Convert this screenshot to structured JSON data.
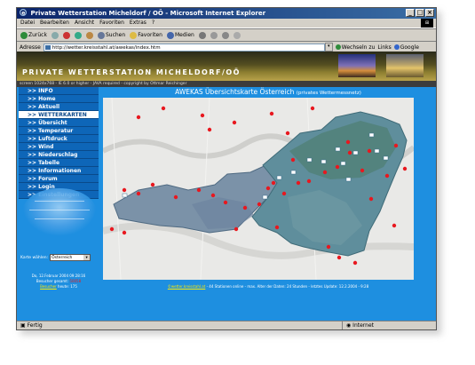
{
  "browser": {
    "window_title": "Private Wetterstation Micheldorf / OÖ - Microsoft Internet Explorer",
    "menu": [
      "Datei",
      "Bearbeiten",
      "Ansicht",
      "Favoriten",
      "Extras",
      "?"
    ],
    "toolbar": {
      "back": "Zurück",
      "search": "Suchen",
      "favorites": "Favoriten",
      "media": "Medien"
    },
    "address_label": "Adresse",
    "address_value": "http://wetter.kreisstahl.at/awekas/index.htm",
    "go_label": "Wechseln zu",
    "links_label": "Links",
    "google_label": "Google"
  },
  "page": {
    "banner_title": "PRIVATE WETTERSTATION MICHELDORF/OÖ",
    "info_line": "screen 1024x768 - IE 6.0 or higher - JAVA required - copyright by Ottmar Reichinger",
    "nav": [
      ">> INFO",
      ">> Home",
      ">> Aktuell",
      ">> WETTERKARTEN",
      ">> Übersicht",
      ">> Temperatur",
      ">> Luftdruck",
      ">> Wind",
      ">> Niederschlag",
      ">> Tabelle",
      ">> Informationen",
      ">> Forum",
      ">> Login",
      ">> Einstellungen"
    ],
    "active_nav_index": 3,
    "map_select_label": "Karte wählen:",
    "map_select_value": "Österreich",
    "date_line": "Do, 12.Februar 2004 09:28:16",
    "visitors_label": "Besucher gesamt:",
    "visitors_value": "50058",
    "visitors_today_link": "Besucher",
    "visitors_today_text": "heute:",
    "visitors_today_value": "175"
  },
  "map": {
    "title": "AWEKAS Übersichtskarte Österreich",
    "subtitle": "(privates Wettermessnetz)",
    "footer_link": "©wetter.kreisstahl.at",
    "footer_text": " - 44 Stationen online - max. Alter der Daten: 24 Stunden - letztes Update: 12.2.2004 - 9:28"
  },
  "status": {
    "left": "Fertig",
    "right": "Internet"
  },
  "colors": {
    "nav_bg": "#1e8fe0",
    "nav_item": "#0e66b8",
    "station_dot": "#e8181f"
  }
}
